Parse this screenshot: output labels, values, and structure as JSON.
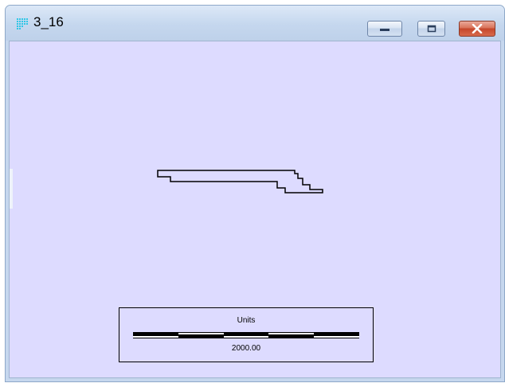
{
  "window": {
    "title": "3_16",
    "icon": "grid-dots-icon",
    "controls": {
      "minimize_icon": "minimize-icon",
      "maximize_icon": "restore-icon",
      "close_icon": "close-icon"
    }
  },
  "map": {
    "background_color": "#dddbff",
    "outline_color": "#000000"
  },
  "scale_bar": {
    "units_label": "Units",
    "value_label": "2000.00"
  }
}
